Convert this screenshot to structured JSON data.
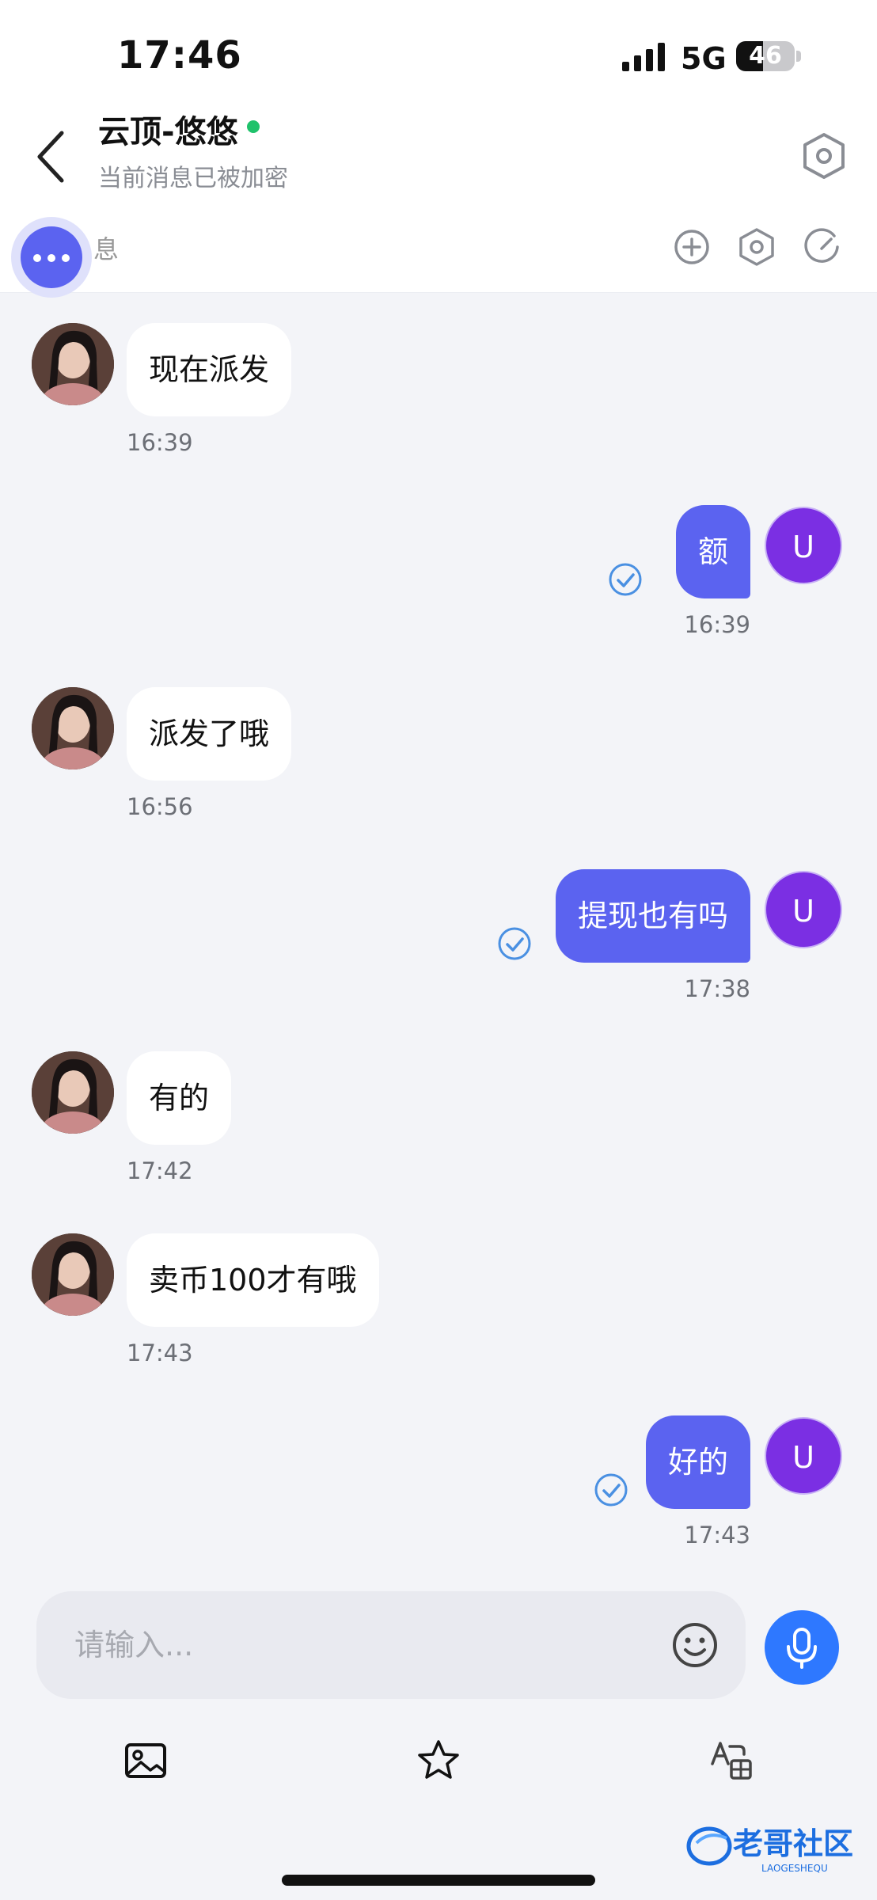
{
  "status_bar": {
    "time": "17:46",
    "network": "5G",
    "battery": "46",
    "battery_level": 0.46
  },
  "header": {
    "title": "云顶-悠悠",
    "subtitle": "当前消息已被加密",
    "online": true
  },
  "toolbar": {
    "partial_label": "息"
  },
  "messages": [
    {
      "side": "in",
      "text": "现在派发",
      "time": "16:39"
    },
    {
      "side": "out",
      "text": "额",
      "time": "16:39",
      "avatar_letter": "U",
      "read": true
    },
    {
      "side": "in",
      "text": "派发了哦",
      "time": "16:56"
    },
    {
      "side": "out",
      "text": "提现也有吗",
      "time": "17:38",
      "avatar_letter": "U",
      "read": true
    },
    {
      "side": "in",
      "text": "有的",
      "time": "17:42"
    },
    {
      "side": "in",
      "text": "卖币100才有哦",
      "time": "17:43"
    },
    {
      "side": "out",
      "text": "好的",
      "time": "17:43",
      "avatar_letter": "U",
      "read": true
    }
  ],
  "composer": {
    "placeholder": "请输入..."
  },
  "bottom_bar": {
    "icons": [
      "image-icon",
      "star-icon",
      "translate-icon"
    ]
  },
  "watermark": {
    "text": "老哥社区",
    "subtext": "LAOGESHEQU"
  },
  "colors": {
    "accent": "#5b63f0",
    "user_avatar": "#7b2fe3",
    "mic": "#2e78ff",
    "online": "#1fc26b"
  }
}
